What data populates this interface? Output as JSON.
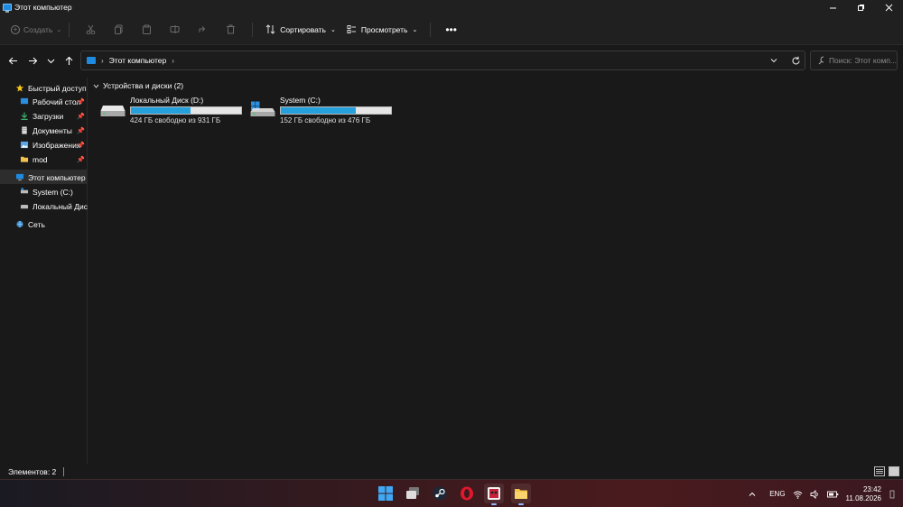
{
  "window": {
    "title": "Этот компьютер"
  },
  "toolbar": {
    "create_label": "Создать",
    "sort_label": "Сортировать",
    "view_label": "Просмотреть",
    "more_label": "•••"
  },
  "address": {
    "segment": "Этот компьютер",
    "search_placeholder": "Поиск: Этот комп..."
  },
  "sidebar": {
    "items": [
      {
        "label": "Быстрый доступ",
        "icon": "star-icon"
      },
      {
        "label": "Рабочий стол",
        "icon": "desktop-icon",
        "pinned": true
      },
      {
        "label": "Загрузки",
        "icon": "download-icon",
        "pinned": true
      },
      {
        "label": "Документы",
        "icon": "document-icon",
        "pinned": true
      },
      {
        "label": "Изображения",
        "icon": "pictures-icon",
        "pinned": true
      },
      {
        "label": "mod",
        "icon": "folder-icon",
        "pinned": true
      },
      {
        "label": "Этот компьютер",
        "icon": "computer-icon",
        "selected": true
      },
      {
        "label": "System (C:)",
        "icon": "drive-icon"
      },
      {
        "label": "Локальный Диск (D:)",
        "icon": "drive-icon"
      },
      {
        "label": "Сеть",
        "icon": "network-icon"
      }
    ]
  },
  "main": {
    "group_header": "Устройства и диски (2)",
    "drives": [
      {
        "name": "Локальный Диск (D:)",
        "free_text": "424 ГБ свободно из 931 ГБ",
        "used_fraction": 0.545,
        "type": "local"
      },
      {
        "name": "System (C:)",
        "free_text": "152 ГБ свободно из 476 ГБ",
        "used_fraction": 0.68,
        "type": "system"
      }
    ]
  },
  "status": {
    "items_text": "Элементов: 2"
  },
  "taskbar": {
    "apps": [
      "windows-start-icon",
      "task-view-icon",
      "steam-icon",
      "opera-icon",
      "game-app-icon",
      "file-explorer-icon"
    ],
    "language": "ENG",
    "time": "23:42",
    "date": "11.08.2026"
  },
  "colors": {
    "accent": "#26a0da",
    "background": "#191919",
    "chrome": "#202020"
  }
}
